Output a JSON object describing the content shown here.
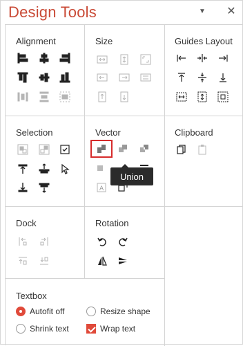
{
  "window": {
    "title": "Design Tools",
    "pin_icon": "dropdown-arrow-icon",
    "close_icon": "close-icon"
  },
  "sections": {
    "alignment": {
      "title": "Alignment"
    },
    "size": {
      "title": "Size"
    },
    "guides": {
      "title": "Guides Layout"
    },
    "selection": {
      "title": "Selection"
    },
    "vector": {
      "title": "Vector",
      "selected": "union",
      "tooltip": "Union"
    },
    "clipboard": {
      "title": "Clipboard"
    },
    "dock": {
      "title": "Dock"
    },
    "rotation": {
      "title": "Rotation"
    },
    "textbox": {
      "title": "Textbox"
    }
  },
  "textbox_options": {
    "autofit_off": {
      "label": "Autofit off",
      "checked": true
    },
    "resize_shape": {
      "label": "Resize shape",
      "checked": false
    },
    "shrink_text": {
      "label": "Shrink text",
      "checked": false
    },
    "wrap_text": {
      "label": "Wrap text",
      "checked": true
    }
  },
  "colors": {
    "accent": "#c94a36",
    "selection": "#d62b2b",
    "tooltip_bg": "#2b2b2b"
  }
}
